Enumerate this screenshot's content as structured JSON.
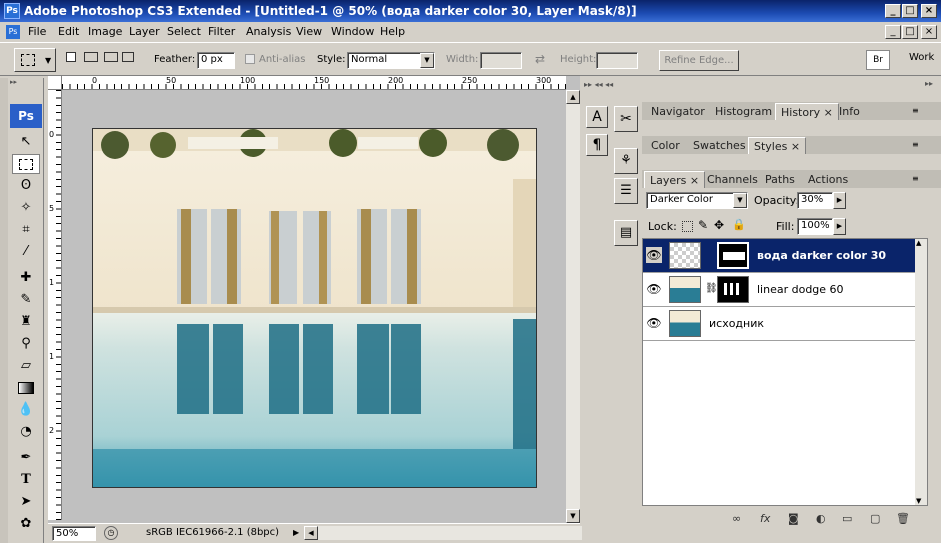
{
  "window": {
    "title": "Adobe Photoshop CS3 Extended - [Untitled-1 @ 50% (вода darker color 30, Layer Mask/8)]",
    "app_logo": "Ps",
    "min_glyph": "_",
    "max_glyph": "□",
    "close_glyph": "×"
  },
  "menubar": {
    "items": [
      "File",
      "Edit",
      "Image",
      "Layer",
      "Select",
      "Filter",
      "Analysis",
      "View",
      "Window",
      "Help"
    ]
  },
  "options": {
    "feather_label": "Feather:",
    "feather_value": "0 px",
    "antialias_label": "Anti-alias",
    "style_label": "Style:",
    "style_value": "Normal",
    "width_label": "Width:",
    "height_label": "Height:",
    "refine_label": "Refine Edge...",
    "workspace_label": "Work"
  },
  "ruler": {
    "h_ticks": [
      "0",
      "50",
      "100",
      "150",
      "200",
      "250",
      "300"
    ],
    "v_ticks": [
      "0",
      "5",
      "1",
      "1",
      "2"
    ]
  },
  "status": {
    "zoom": "50%",
    "doc_info": "sRGB IEC61966-2.1 (8bpc)"
  },
  "panels": {
    "group1_tabs": [
      "Navigator",
      "Histogram",
      "History",
      "Info"
    ],
    "group1_active": "History",
    "group2_tabs": [
      "Color",
      "Swatches",
      "Styles"
    ],
    "group2_active": "Styles",
    "group3_tabs": [
      "Layers",
      "Channels",
      "Paths",
      "Actions"
    ],
    "group3_active": "Layers"
  },
  "layers_panel": {
    "blend_mode": "Darker Color",
    "opacity_label": "Opacity:",
    "opacity_value": "30%",
    "lock_label": "Lock:",
    "fill_label": "Fill:",
    "fill_value": "100%",
    "layers": [
      {
        "name": "вода darker color 30",
        "selected": true,
        "has_mask": true
      },
      {
        "name": "linear dodge 60",
        "selected": false,
        "has_mask": true
      },
      {
        "name": "исходник",
        "selected": false,
        "has_mask": false
      }
    ],
    "footer_icons": [
      "link-icon",
      "fx-icon",
      "mask-icon",
      "adjustment-icon",
      "folder-icon",
      "new-layer-icon",
      "trash-icon"
    ],
    "footer_labels": [
      "∞",
      "fx",
      "◙",
      "◐",
      "▭",
      "▢",
      "🗑"
    ]
  },
  "colors": {
    "titlebar": "#0a246a",
    "selection": "#0a246a",
    "chrome": "#d4d0c8"
  }
}
